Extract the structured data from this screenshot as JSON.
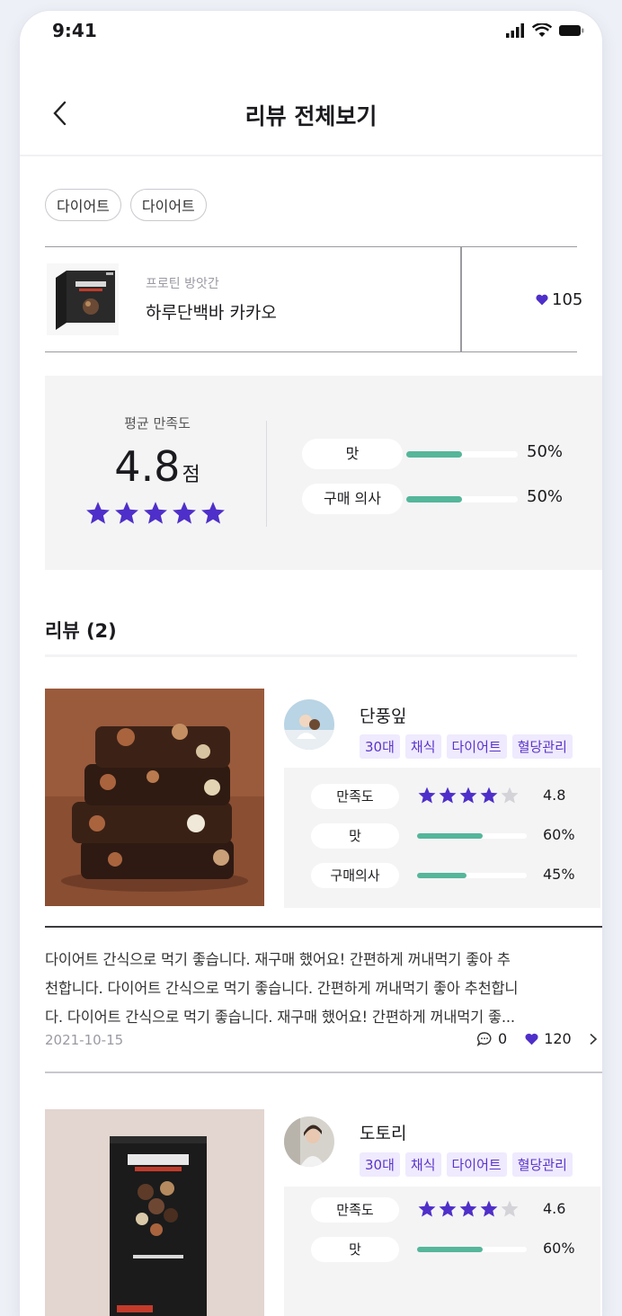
{
  "status_bar": {
    "time": "9:41"
  },
  "header": {
    "title": "리뷰 전체보기"
  },
  "chips": [
    "다이어트",
    "다이어트"
  ],
  "product": {
    "category": "프로틴 방앗간",
    "name": "하루단백바 카카오",
    "likes": "105"
  },
  "summary": {
    "label": "평균 만족도",
    "score": "4.8",
    "unit": "점",
    "stars": 5,
    "metrics": [
      {
        "label": "맛",
        "value": "50%",
        "fraction": 0.5
      },
      {
        "label": "구매 의사",
        "value": "50%",
        "fraction": 0.5
      }
    ]
  },
  "reviews_title": "리뷰 (2)",
  "reviews": [
    {
      "name": "단풍잎",
      "tags": [
        "30대",
        "채식",
        "다이어트",
        "혈당관리"
      ],
      "rating_label": "만족도",
      "rating_stars": 4,
      "rating_value": "4.8",
      "taste_label": "맛",
      "taste_value": "60%",
      "taste_fraction": 0.6,
      "intent_label": "구매의사",
      "intent_value": "45%",
      "intent_fraction": 0.45,
      "text_lines": [
        "다이어트 간식으로 먹기 좋습니다. 재구매 했어요! 간편하게 꺼내먹기 좋아 추",
        "천합니다. 다이어트 간식으로 먹기 좋습니다. 간편하게 꺼내먹기 좋아 추천합니",
        "다. 다이어트 간식으로 먹기 좋습니다. 재구매 했어요! 간편하게 꺼내먹기 좋..."
      ],
      "date": "2021-10-15",
      "comments": "0",
      "likes": "120"
    },
    {
      "name": "도토리",
      "tags": [
        "30대",
        "채식",
        "다이어트",
        "혈당관리"
      ],
      "rating_label": "만족도",
      "rating_stars": 4,
      "rating_value": "4.6",
      "taste_label": "맛",
      "taste_value": "60%",
      "taste_fraction": 0.6
    }
  ],
  "colors": {
    "accent": "#4f2fc9",
    "bar": "#55b69a",
    "panel": "#f4f4f5",
    "tag_bg": "#efeafe",
    "tag_text": "#5a35c8"
  },
  "icons": [
    "back-chevron-icon",
    "signal-icon",
    "wifi-icon",
    "battery-icon",
    "heart-icon",
    "star-icon",
    "comment-icon",
    "chevron-right-icon"
  ]
}
